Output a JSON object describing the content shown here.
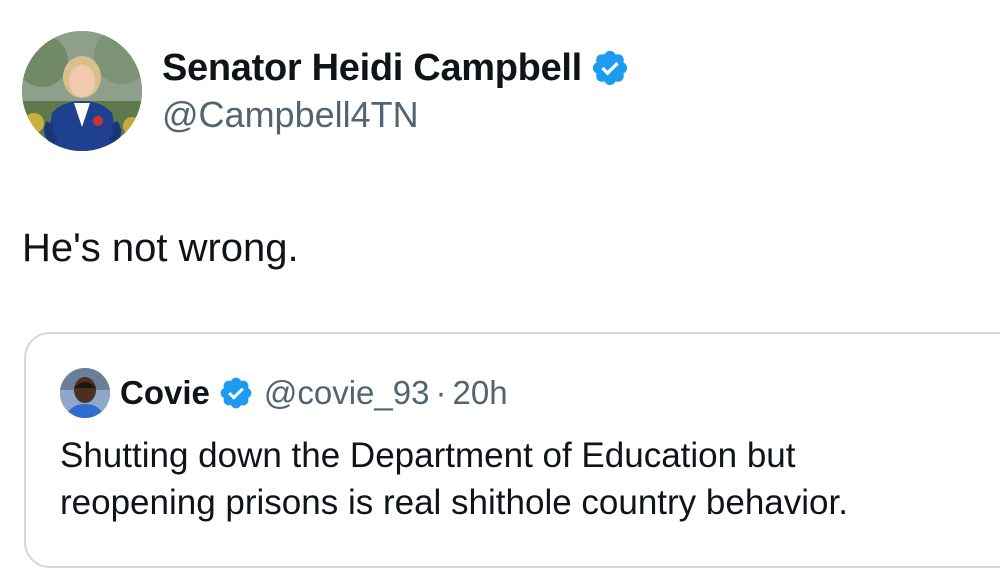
{
  "tweet": {
    "author": {
      "name": "Senator Heidi Campbell",
      "handle": "@Campbell4TN",
      "verified": true
    },
    "text": "He's not wrong.",
    "quoted": {
      "author": {
        "name": "Covie",
        "handle": "@covie_93",
        "verified": true
      },
      "separator": "·",
      "time": "20h",
      "text_lines": [
        "Shutting down the Department of Education but",
        "reopening prisons is real shithole country behavior."
      ]
    }
  },
  "icons": {
    "verified": "verified-badge-icon"
  },
  "colors": {
    "verified_blue": "#1d9bf0",
    "text_primary": "#0f1419",
    "text_secondary": "#536471",
    "border": "#cfd9de"
  }
}
